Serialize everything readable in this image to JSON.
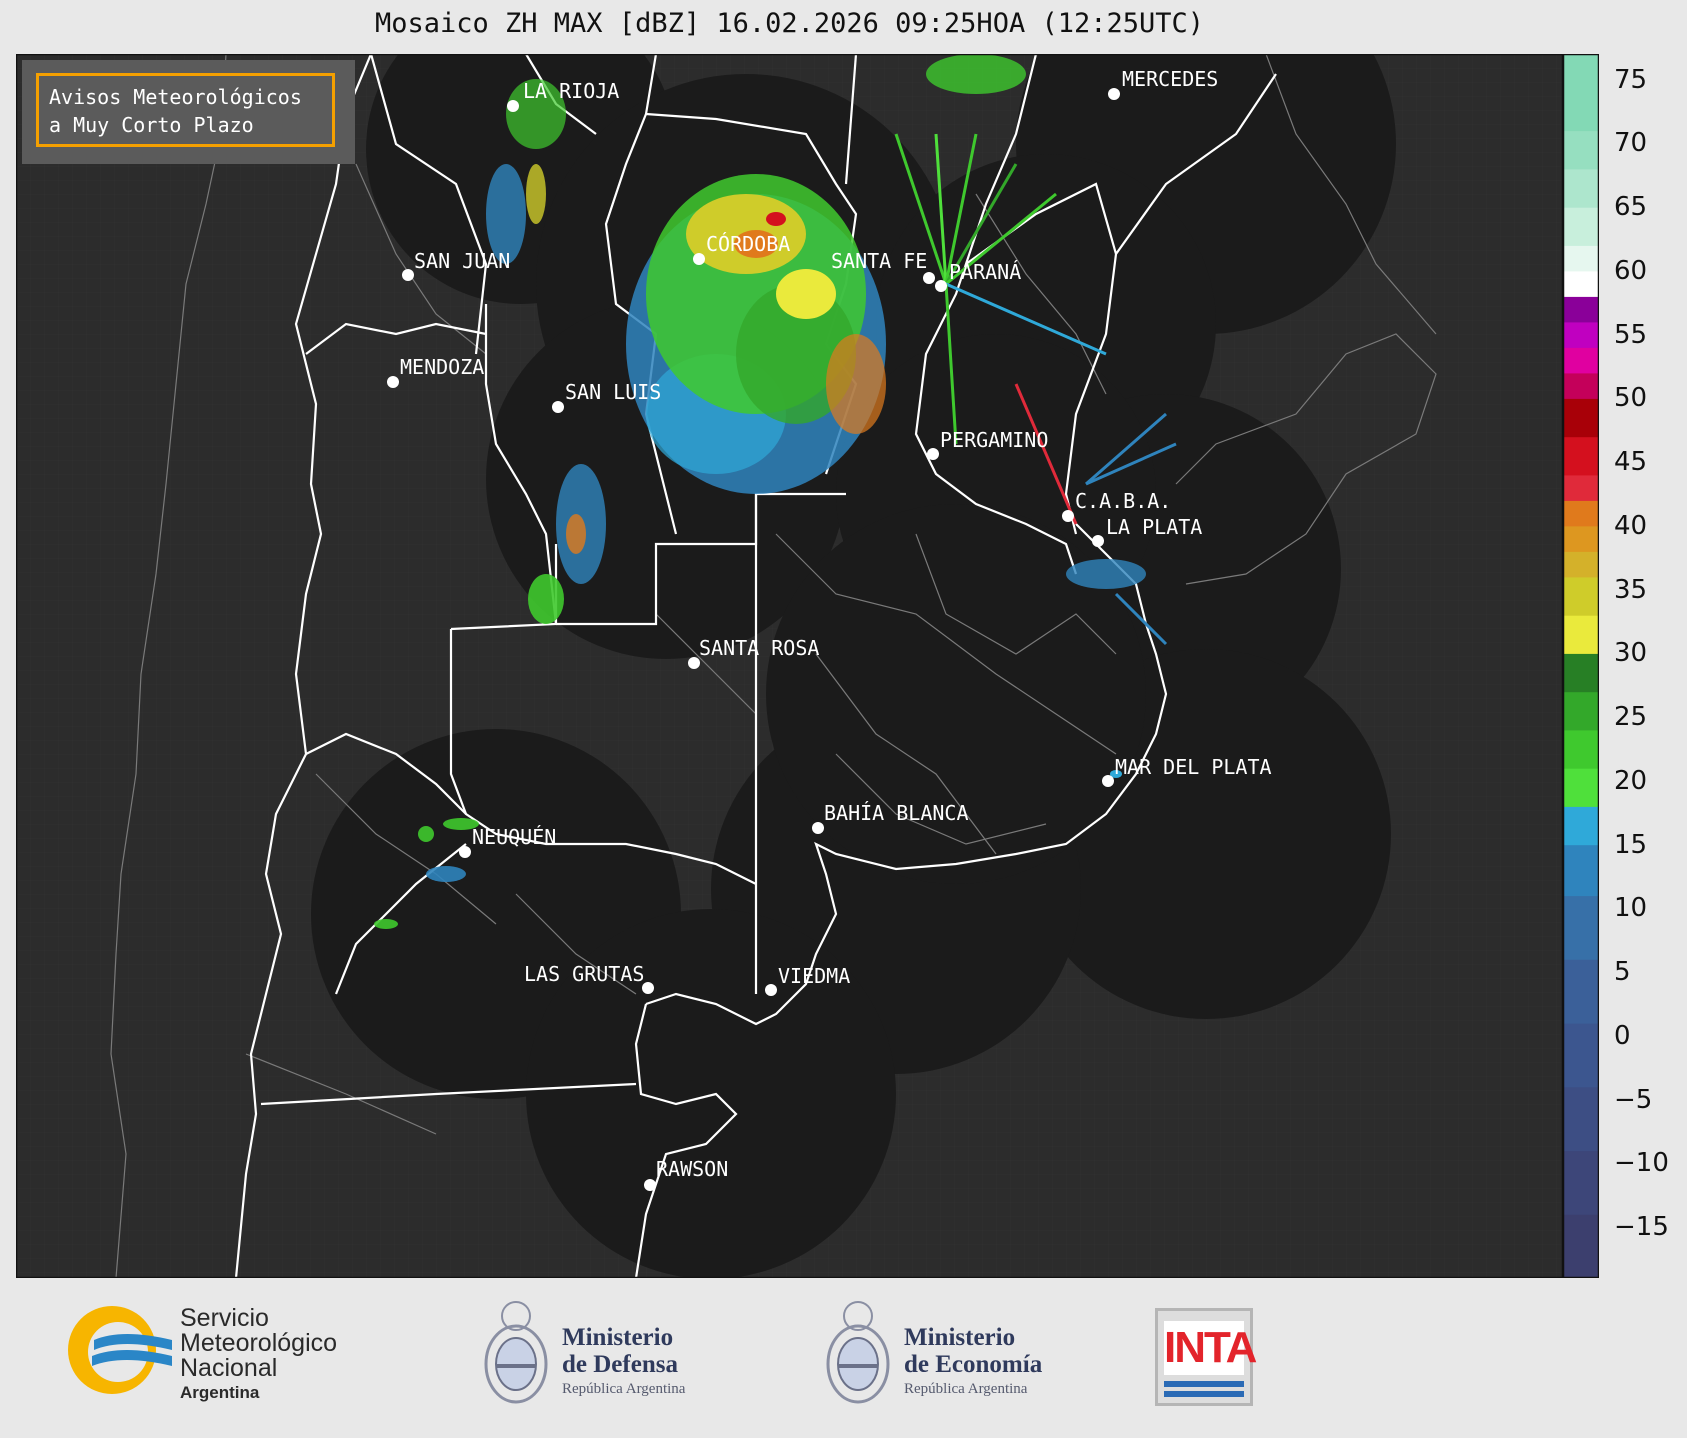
{
  "title": "Mosaico ZH MAX [dBZ] 16.02.2026 09:25HOA (12:25UTC)",
  "avisos": {
    "line1": "Avisos Meteorológicos",
    "line2": "a Muy Corto Plazo"
  },
  "colors": {
    "map_bg": "#2c2c2c",
    "radar_coverage": "#1b1b1b",
    "boundary_primary": "#ffffff",
    "boundary_secondary": "#7a7a7a",
    "label": "#ffffff",
    "avisos_border": "#f5a000"
  },
  "cities": [
    {
      "id": "la-rioja",
      "name": "LA RIOJA"
    },
    {
      "id": "mercedes",
      "name": "MERCEDES"
    },
    {
      "id": "cordoba",
      "name": "CÓRDOBA"
    },
    {
      "id": "san-juan",
      "name": "SAN JUAN"
    },
    {
      "id": "santa-fe",
      "name": "SANTA FE"
    },
    {
      "id": "parana",
      "name": "PARANÁ"
    },
    {
      "id": "mendoza",
      "name": "MENDOZA"
    },
    {
      "id": "san-luis",
      "name": "SAN LUIS"
    },
    {
      "id": "pergamino",
      "name": "PERGAMINO"
    },
    {
      "id": "caba",
      "name": "C.A.B.A."
    },
    {
      "id": "la-plata",
      "name": "LA PLATA"
    },
    {
      "id": "santa-rosa",
      "name": "SANTA ROSA"
    },
    {
      "id": "mar-del-plata",
      "name": "MAR DEL PLATA"
    },
    {
      "id": "bahia-blanca",
      "name": "BAHÍA BLANCA"
    },
    {
      "id": "neuquen",
      "name": "NEUQUÉN"
    },
    {
      "id": "las-grutas",
      "name": "LAS GRUTAS"
    },
    {
      "id": "viedma",
      "name": "VIEDMA"
    },
    {
      "id": "rawson",
      "name": "RAWSON"
    }
  ],
  "colorbar": {
    "unit": "dBZ",
    "range": [
      -19,
      77
    ],
    "ticks": [
      "75",
      "70",
      "65",
      "60",
      "55",
      "50",
      "45",
      "40",
      "35",
      "30",
      "25",
      "20",
      "15",
      "10",
      "5",
      "0",
      "−5",
      "−10",
      "−15"
    ],
    "tick_values": [
      75,
      70,
      65,
      60,
      55,
      50,
      45,
      40,
      35,
      30,
      25,
      20,
      15,
      10,
      5,
      0,
      -5,
      -10,
      -15
    ],
    "bands": [
      {
        "from": -19,
        "to": -14,
        "color": "#3c3f6e"
      },
      {
        "from": -14,
        "to": -9,
        "color": "#3d4679"
      },
      {
        "from": -9,
        "to": -4,
        "color": "#3d4e84"
      },
      {
        "from": -4,
        "to": 1,
        "color": "#3c568f"
      },
      {
        "from": 1,
        "to": 6,
        "color": "#3b6099"
      },
      {
        "from": 6,
        "to": 11,
        "color": "#3770a8"
      },
      {
        "from": 11,
        "to": 15,
        "color": "#2f84bd"
      },
      {
        "from": 15,
        "to": 18,
        "color": "#2fa9d9"
      },
      {
        "from": 18,
        "to": 21,
        "color": "#4fe03b"
      },
      {
        "from": 21,
        "to": 24,
        "color": "#3fc92e"
      },
      {
        "from": 24,
        "to": 27,
        "color": "#33a82a"
      },
      {
        "from": 27,
        "to": 30,
        "color": "#277f25"
      },
      {
        "from": 30,
        "to": 33,
        "color": "#eaea3c"
      },
      {
        "from": 33,
        "to": 36,
        "color": "#cfcc2a"
      },
      {
        "from": 36,
        "to": 38,
        "color": "#d4b12a"
      },
      {
        "from": 38,
        "to": 40,
        "color": "#dd9720"
      },
      {
        "from": 40,
        "to": 42,
        "color": "#e07a1c"
      },
      {
        "from": 42,
        "to": 44,
        "color": "#e02a3a"
      },
      {
        "from": 44,
        "to": 47,
        "color": "#d4101e"
      },
      {
        "from": 47,
        "to": 50,
        "color": "#a80008"
      },
      {
        "from": 50,
        "to": 52,
        "color": "#c4005a"
      },
      {
        "from": 52,
        "to": 54,
        "color": "#e000a0"
      },
      {
        "from": 54,
        "to": 56,
        "color": "#c000c0"
      },
      {
        "from": 56,
        "to": 58,
        "color": "#8a0099"
      },
      {
        "from": 58,
        "to": 60,
        "color": "#ffffff"
      },
      {
        "from": 60,
        "to": 62,
        "color": "#e6f7ef"
      },
      {
        "from": 62,
        "to": 65,
        "color": "#c8efdc"
      },
      {
        "from": 65,
        "to": 68,
        "color": "#ade6cd"
      },
      {
        "from": 68,
        "to": 71,
        "color": "#96dfc0"
      },
      {
        "from": 71,
        "to": 77,
        "color": "#83d9b5"
      }
    ]
  },
  "footer": {
    "smn": {
      "line1": "Servicio",
      "line2": "Meteorológico",
      "line3": "Nacional",
      "country": "Argentina"
    },
    "defensa": {
      "line1": "Ministerio",
      "line2": "de Defensa",
      "sub": "República Argentina"
    },
    "economia": {
      "line1": "Ministerio",
      "line2": "de Economía",
      "sub": "República Argentina"
    },
    "inta": {
      "word": "INTA"
    }
  }
}
